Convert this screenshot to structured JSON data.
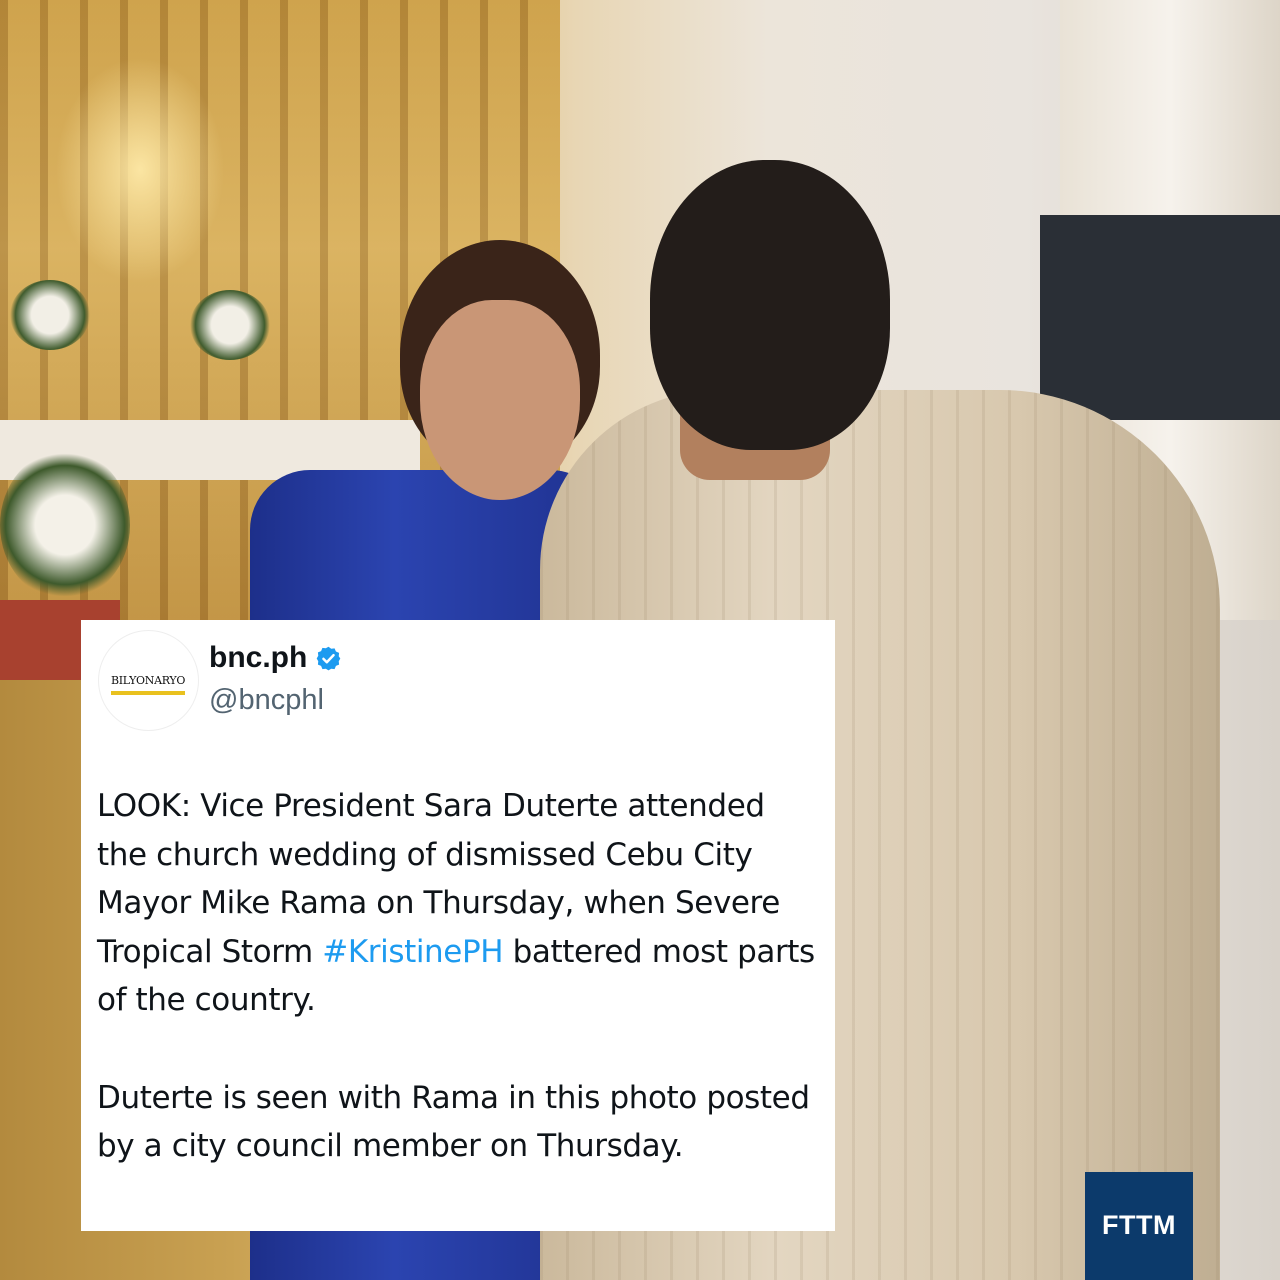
{
  "post": {
    "avatar_logo_text": "BILYONARYO",
    "display_name": "bnc.ph",
    "verified": true,
    "handle": "@bncphl",
    "text_line_1": "LOOK: Vice President Sara Duterte attended the church wedding of dismissed Cebu City Mayor Mike Rama on Thursday, when Severe Tropical Storm ",
    "hashtag": "#KristinePH",
    "text_line_1_end": " battered most parts of the country.",
    "text_paragraph_2": "Duterte is seen with Rama in this photo posted by a city council member on Thursday."
  },
  "watermark": {
    "label": "FTTM"
  },
  "colors": {
    "card_background": "#ffffff",
    "hashtag": "#1d9bf0",
    "verified_badge": "#1d9bf0",
    "handle_gray": "#536471",
    "watermark_background": "#0c3a6b"
  },
  "icons": {
    "verified": "verified-badge-icon"
  }
}
